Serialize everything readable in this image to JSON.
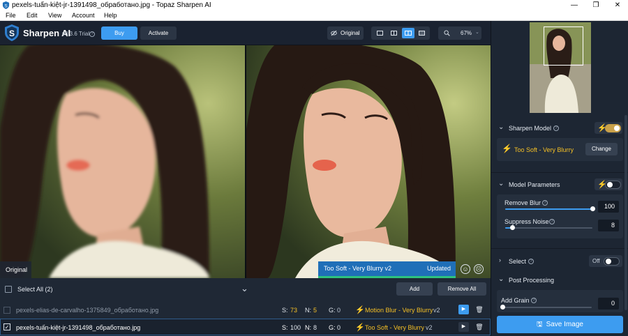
{
  "window": {
    "title": "pexels-tuấn-kiệt-jr-1391498_обработано.jpg - Topaz Sharpen AI",
    "controls": {
      "minimize": "—",
      "maximize": "❐",
      "close": "✕"
    }
  },
  "menu": [
    "File",
    "Edit",
    "View",
    "Account",
    "Help"
  ],
  "app": {
    "name": "Sharpen AI",
    "version": "v3.3.6 Trial"
  },
  "toolbar": {
    "buy_label": "Buy",
    "activate_label": "Activate",
    "original_label": "Original",
    "zoom": "67%"
  },
  "preview": {
    "original_badge": "Original",
    "model_banner": "Too Soft - Very Blurry v2",
    "status": "Updated"
  },
  "filebar": {
    "select_all": "Select All (2)",
    "add_label": "Add",
    "remove_all_label": "Remove All",
    "files": [
      {
        "name": "pexels-elias-de-carvalho-1375849_обработано.jpg",
        "s_label": "S:",
        "s": "73",
        "n_label": "N:",
        "n": "5",
        "g_label": "G:",
        "g": "0",
        "model": "Motion Blur - Very Blurry",
        "ver": "v2",
        "checked": false
      },
      {
        "name": "pexels-tuấn-kiệt-jr-1391498_обработано.jpg",
        "s_label": "S:",
        "s": "100",
        "n_label": "N:",
        "n": "8",
        "g_label": "G:",
        "g": "0",
        "model": "Too Soft - Very Blurry",
        "ver": "v2",
        "checked": true
      }
    ]
  },
  "panel": {
    "sharpen_model": {
      "title": "Sharpen Model",
      "model": "Too Soft - Very Blurry",
      "change_label": "Change",
      "auto_on": true
    },
    "model_parameters": {
      "title": "Model Parameters",
      "auto_on": false,
      "remove_blur": {
        "label": "Remove Blur",
        "value": "100",
        "fraction": 1.0
      },
      "suppress_noise": {
        "label": "Suppress Noise",
        "value": "8",
        "fraction": 0.08
      }
    },
    "select": {
      "title": "Select",
      "state": "Off"
    },
    "post_processing": {
      "title": "Post Processing",
      "add_grain": {
        "label": "Add Grain",
        "value": "0",
        "fraction": 0.0
      }
    },
    "save_label": "Save Image"
  },
  "colors": {
    "accent": "#3d9cf0",
    "bolt": "#f5c026",
    "toggle_on": "#c9a14a",
    "banner": "#1f6fb8",
    "progress": "#2ec27e"
  }
}
